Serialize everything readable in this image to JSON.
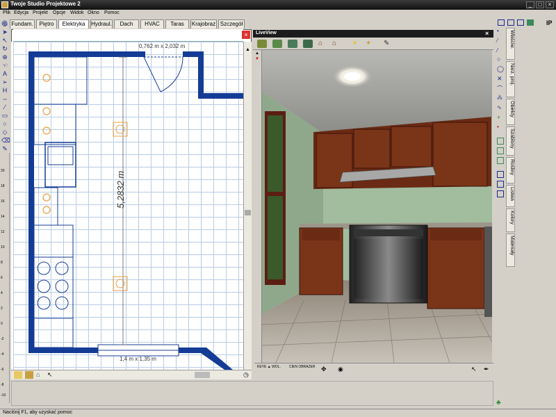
{
  "window": {
    "title": "Twoje Studio Projektowe 2",
    "minimize": "_",
    "maximize": "□",
    "close": "×"
  },
  "menu": [
    "Plik",
    "Edycja",
    "Projekt",
    "Opcje",
    "Widok",
    "Okno",
    "Pomoc"
  ],
  "tabs": [
    {
      "label": "Fundam.",
      "active": false
    },
    {
      "label": "Piętro",
      "active": false
    },
    {
      "label": "Elektryka",
      "active": true
    },
    {
      "label": "Hydraul.",
      "active": false
    },
    {
      "label": "Dach",
      "active": false
    },
    {
      "label": "HVAC",
      "active": false
    },
    {
      "label": "Taras",
      "active": false
    },
    {
      "label": "Krajobraz",
      "active": false
    },
    {
      "label": "Szczegół",
      "active": false
    }
  ],
  "plan": {
    "door_dim": "0,762 m x 2,032 m",
    "length_dim": "5,2832 m",
    "window_dim": "1,4 m x 1,35 m"
  },
  "ruler_ticks": [
    "20",
    "18",
    "16",
    "14",
    "12",
    "10",
    "8",
    "6",
    "4",
    "2",
    "0",
    "-2",
    "-4",
    "-6",
    "-8",
    "-10"
  ],
  "liveview": {
    "title": "LiveView",
    "bottom_label_1": "KEYE ▲ WOL.",
    "bottom_label_2": "CIEN OBRAZER"
  },
  "right_vtabs": [
    "Właściw.",
    "Narz. proj.",
    "Obiekty",
    "Szablony",
    "Rośliny",
    "Listwa",
    "Kolory",
    "Materiały"
  ],
  "status": {
    "help_text": "Naciśnij F1, aby uzyskać pomoc"
  },
  "colors": {
    "wall": "#143c96",
    "fixture": "#e8a040",
    "grid": "#b9cce6",
    "cabinet": "#7a3418",
    "room_wall": "#a2bc9e"
  }
}
